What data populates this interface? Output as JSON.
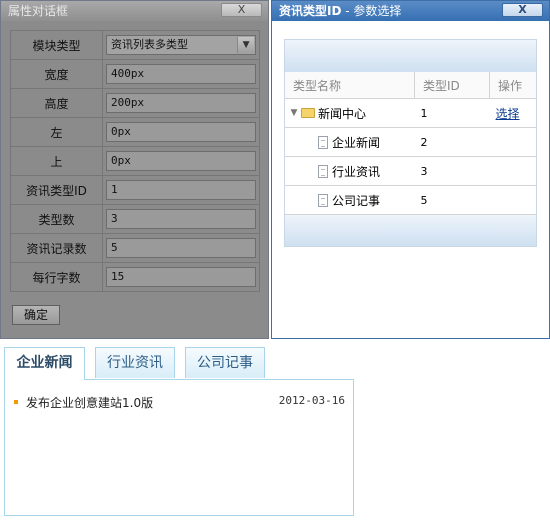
{
  "property_dialog": {
    "title": "属性对话框",
    "close_label": "X",
    "rows": [
      {
        "label": "模块类型",
        "value": "资讯列表多类型",
        "type": "select"
      },
      {
        "label": "宽度",
        "value": "400px"
      },
      {
        "label": "高度",
        "value": "200px"
      },
      {
        "label": "左",
        "value": "0px"
      },
      {
        "label": "上",
        "value": "0px"
      },
      {
        "label": "资讯类型ID",
        "value": "1"
      },
      {
        "label": "类型数",
        "value": "3"
      },
      {
        "label": "资讯记录数",
        "value": "5"
      },
      {
        "label": "每行字数",
        "value": "15"
      }
    ],
    "ok_label": "确定"
  },
  "param_dialog": {
    "title": "资讯类型ID",
    "title_suffix": " - 参数选择",
    "close_label": "X",
    "columns": [
      "类型名称",
      "类型ID",
      "操作"
    ],
    "tree": [
      {
        "name": "新闻中心",
        "id": "1",
        "action": "选择",
        "expanded": true,
        "level": 0,
        "icon": "folder-icon"
      },
      {
        "name": "企业新闻",
        "id": "2",
        "level": 1,
        "icon": "document-icon"
      },
      {
        "name": "行业资讯",
        "id": "3",
        "level": 1,
        "icon": "document-icon"
      },
      {
        "name": "公司记事",
        "id": "5",
        "level": 1,
        "icon": "document-icon"
      }
    ]
  },
  "preview": {
    "tabs": [
      {
        "label": "企业新闻",
        "active": true
      },
      {
        "label": "行业资讯",
        "active": false
      },
      {
        "label": "公司记事",
        "active": false
      }
    ],
    "items": [
      {
        "title": "发布企业创意建站1.0版",
        "date": "2012-03-16"
      }
    ]
  },
  "colors": {
    "dialog_gray": "#8b8b8b",
    "param_title_blue": "#356fb3",
    "tab_border": "#a9d5ea",
    "bullet_orange": "#f09a00",
    "link_blue": "#0b3c91"
  }
}
